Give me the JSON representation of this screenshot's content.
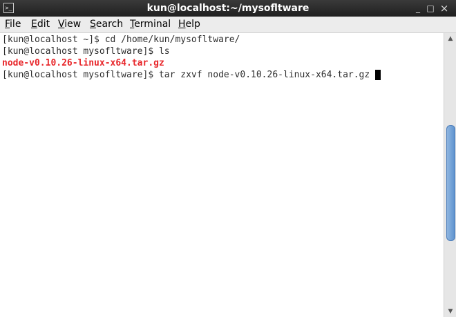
{
  "window": {
    "title": "kun@localhost:~/mysofltware",
    "app_icon": ">_",
    "controls": {
      "minimize": "_",
      "maximize": "□",
      "close": "×"
    }
  },
  "menubar": {
    "items": [
      {
        "accel": "F",
        "rest": "ile"
      },
      {
        "accel": "E",
        "rest": "dit"
      },
      {
        "accel": "V",
        "rest": "iew"
      },
      {
        "accel": "S",
        "rest": "earch"
      },
      {
        "accel": "T",
        "rest": "erminal"
      },
      {
        "accel": "H",
        "rest": "elp"
      }
    ]
  },
  "terminal": {
    "lines": [
      "[kun@localhost ~]$ cd /home/kun/mysofltware/",
      "[kun@localhost mysofltware]$ ls",
      "node-v0.10.26-linux-x64.tar.gz",
      "[kun@localhost mysofltware]$ tar zxvf node-v0.10.26-linux-x64.tar.gz "
    ],
    "colors": {
      "text": "#2e2e2e",
      "archive": "#e8262a",
      "cursor": "#000000"
    }
  },
  "scrollbar": {
    "up_icon": "▲",
    "down_icon": "▼",
    "position_fraction": 0.55,
    "visible_fraction": 0.44
  }
}
